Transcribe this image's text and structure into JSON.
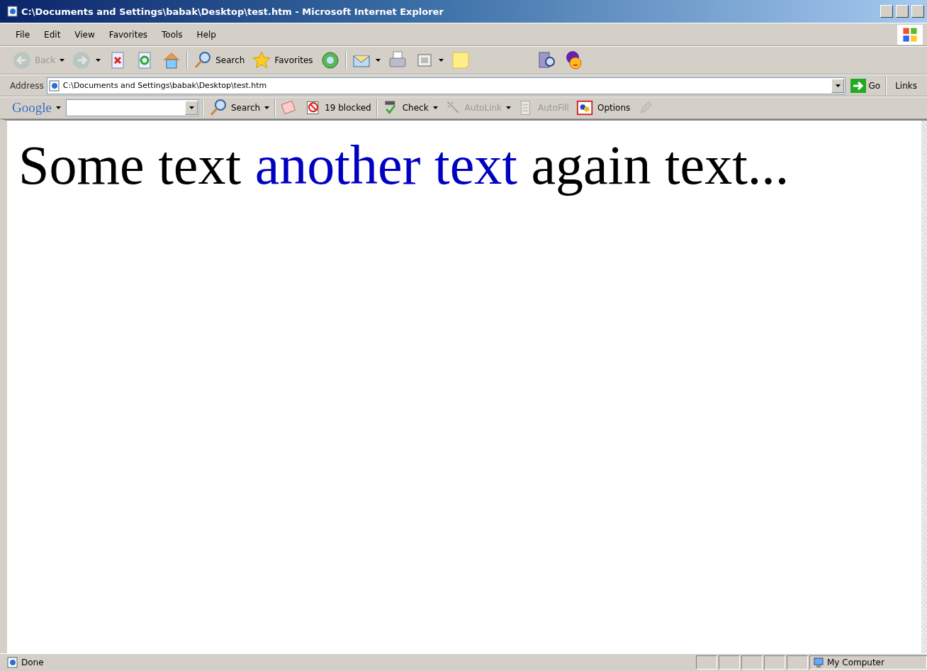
{
  "window": {
    "title": "C:\\Documents and Settings\\babak\\Desktop\\test.htm - Microsoft Internet Explorer"
  },
  "menu": [
    {
      "label": "File"
    },
    {
      "label": "Edit"
    },
    {
      "label": "View"
    },
    {
      "label": "Favorites"
    },
    {
      "label": "Tools"
    },
    {
      "label": "Help"
    }
  ],
  "toolbar": [
    {
      "kind": "back",
      "label": "Back",
      "disabled": true,
      "dropdown": true
    },
    {
      "kind": "forward",
      "disabled": true,
      "dropdown": true
    },
    {
      "kind": "stop",
      "disabled": false,
      "dropdown": false
    },
    {
      "kind": "refresh",
      "disabled": false,
      "dropdown": false
    },
    {
      "kind": "home",
      "disabled": false,
      "dropdown": false
    },
    {
      "kind": "search",
      "label": "Search",
      "disabled": false,
      "dropdown": false
    },
    {
      "kind": "favorites",
      "label": "Favorites",
      "disabled": false,
      "dropdown": false
    },
    {
      "kind": "media",
      "disabled": false,
      "dropdown": false
    },
    {
      "kind": "mail",
      "disabled": false,
      "dropdown": true
    },
    {
      "kind": "print",
      "disabled": false,
      "dropdown": false
    },
    {
      "kind": "edit",
      "disabled": false,
      "dropdown": true
    },
    {
      "kind": "note",
      "disabled": false,
      "dropdown": false
    },
    {
      "kind": "research",
      "disabled": false,
      "dropdown": false
    },
    {
      "kind": "messenger",
      "disabled": false,
      "dropdown": false
    }
  ],
  "address_bar": {
    "label": "Address",
    "value": "C:\\Documents and Settings\\babak\\Desktop\\test.htm",
    "go": "Go",
    "links": "Links"
  },
  "google_toolbar": {
    "logo": "Google",
    "items": [
      {
        "kind": "search",
        "label": "Search",
        "disabled": false,
        "dropdown": true
      },
      {
        "kind": "popup",
        "disabled": false,
        "dropdown": false
      },
      {
        "kind": "blocked",
        "label": "19 blocked",
        "disabled": false,
        "dropdown": false
      },
      {
        "kind": "check",
        "label": "Check",
        "disabled": false,
        "dropdown": true
      },
      {
        "kind": "autolink",
        "label": "AutoLink",
        "disabled": true,
        "dropdown": true
      },
      {
        "kind": "autofill",
        "label": "AutoFill",
        "disabled": true,
        "dropdown": false
      },
      {
        "kind": "options",
        "label": "Options",
        "disabled": false,
        "dropdown": false
      },
      {
        "kind": "pencil",
        "disabled": true,
        "dropdown": false
      }
    ]
  },
  "content": {
    "segments": [
      {
        "text": "Some text ",
        "kind": "plain"
      },
      {
        "text": "another text",
        "kind": "highlight"
      },
      {
        "text": " again text...",
        "kind": "plain"
      }
    ]
  },
  "status_bar": {
    "text": "Done",
    "zone": "My Computer"
  }
}
